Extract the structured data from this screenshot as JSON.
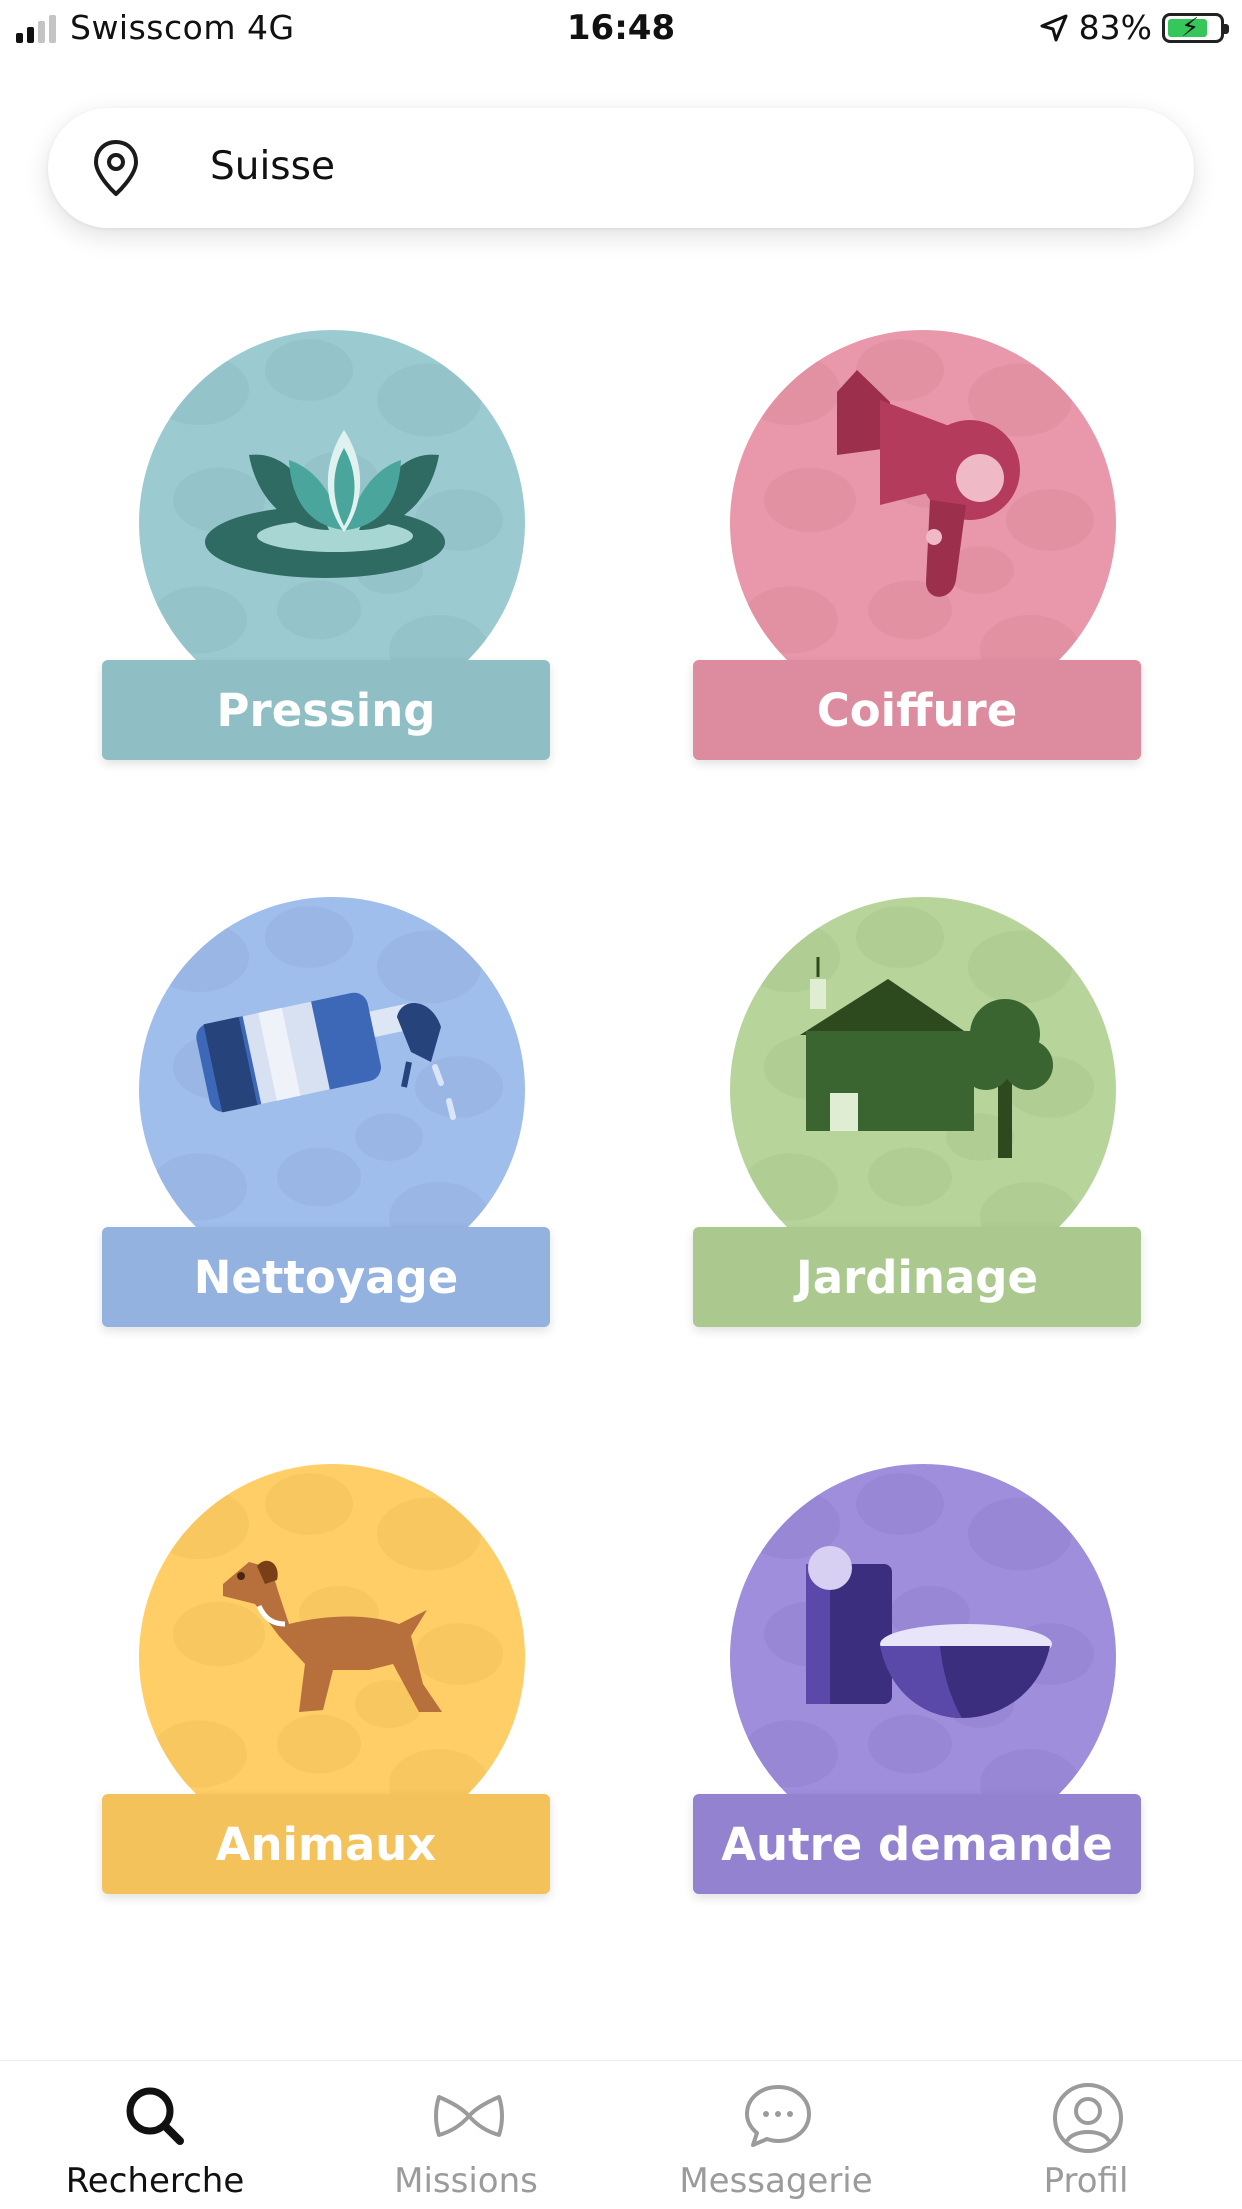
{
  "status_bar": {
    "carrier": "Swisscom 4G",
    "time": "16:48",
    "battery": "83%"
  },
  "search": {
    "value": "Suisse",
    "icon": "location-pin-icon"
  },
  "categories": [
    {
      "label": "Pressing",
      "icon": "lotus-icon",
      "color": "#8fbfc5"
    },
    {
      "label": "Coiffure",
      "icon": "hair-dryer-icon",
      "color": "#dc8c9e"
    },
    {
      "label": "Nettoyage",
      "icon": "spray-bottle-icon",
      "color": "#94b2df"
    },
    {
      "label": "Jardinage",
      "icon": "house-tree-icon",
      "color": "#abc98f"
    },
    {
      "label": "Animaux",
      "icon": "dog-icon",
      "color": "#f4c25a"
    },
    {
      "label": "Autre demande",
      "icon": "cup-bowl-icon",
      "color": "#9382d0"
    }
  ],
  "tabs": [
    {
      "label": "Recherche",
      "icon": "search-icon",
      "active": true
    },
    {
      "label": "Missions",
      "icon": "bow-icon",
      "active": false
    },
    {
      "label": "Messagerie",
      "icon": "chat-icon",
      "active": false
    },
    {
      "label": "Profil",
      "icon": "profile-icon",
      "active": false
    }
  ]
}
